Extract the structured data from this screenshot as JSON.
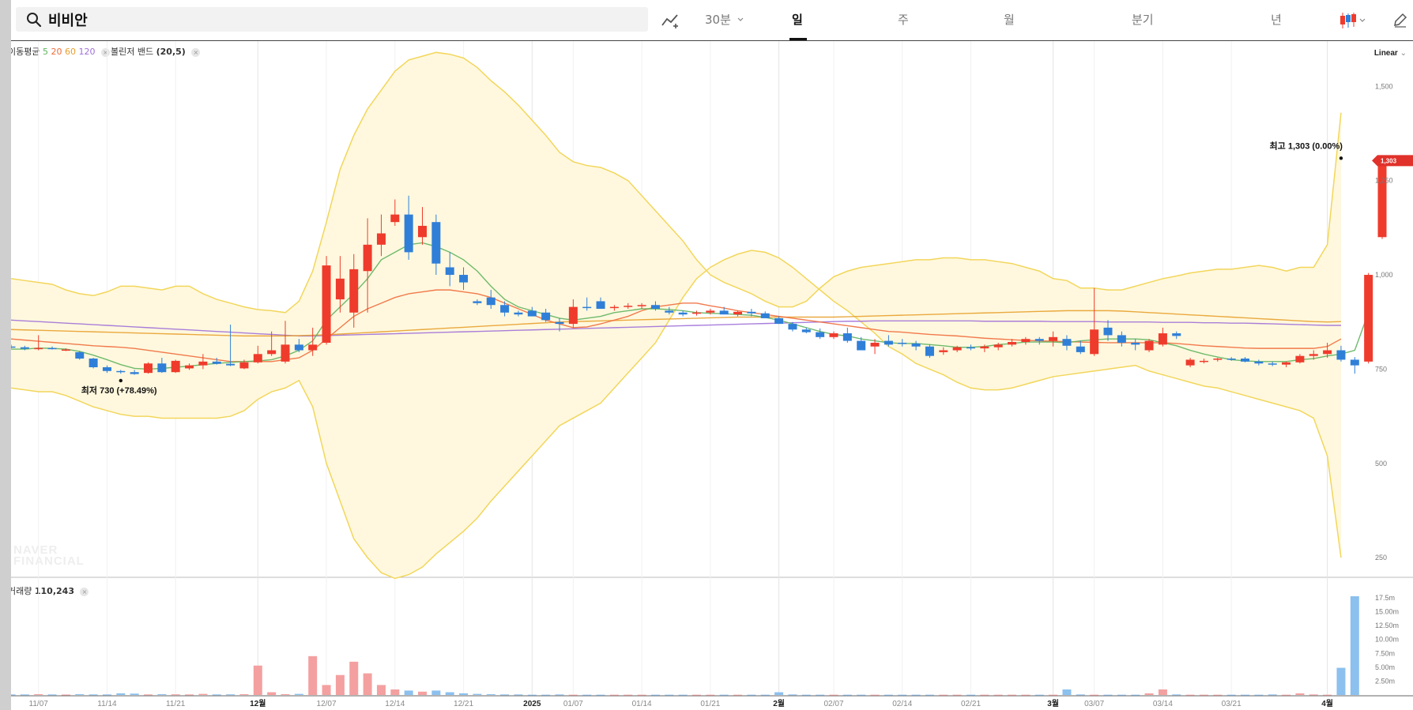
{
  "search": {
    "query": "비비안"
  },
  "toolbar": {
    "interval_30m": "30분",
    "tabs": [
      "일",
      "주",
      "월",
      "분기",
      "년"
    ],
    "active_tab": "일"
  },
  "indicators": {
    "ma_label": "이동평균",
    "ma_periods": [
      "5",
      "20",
      "60",
      "120"
    ],
    "ma_colors": [
      "#5fb35f",
      "#ef6c3c",
      "#e8a02c",
      "#a070d8"
    ],
    "bollinger_label": "볼린저 밴드",
    "bollinger_params": "(20,5)"
  },
  "scale_mode": "Linear",
  "volume": {
    "label": "거래량",
    "value": "110,243"
  },
  "watermark": [
    "NAVER",
    "FINANCIAL"
  ],
  "colors": {
    "up": "#ef3b2c",
    "down": "#2f7fd8",
    "band_fill": "#fff8de",
    "band_line": "#f2d65b",
    "vol_up": "#f4a0a0",
    "vol_down": "#8cc0ef"
  },
  "chart_data": {
    "type": "candlestick",
    "price_axis": {
      "min": 200,
      "max": 1620,
      "ticks": [
        250,
        500,
        750,
        1000,
        1250,
        1500
      ]
    },
    "volume_axis": {
      "max": 18.5,
      "ticks": [
        2.5,
        5.0,
        7.5,
        10.0,
        12.5,
        15.0,
        17.5
      ],
      "tick_labels": [
        "2.50m",
        "5.00m",
        "7.50m",
        "10.00m",
        "12.50m",
        "15.00m",
        "17.5m"
      ]
    },
    "x_labels": [
      {
        "i": 2,
        "t": "11/07",
        "b": false
      },
      {
        "i": 7,
        "t": "11/14",
        "b": false
      },
      {
        "i": 12,
        "t": "11/21",
        "b": false
      },
      {
        "i": 18,
        "t": "12월",
        "b": true
      },
      {
        "i": 23,
        "t": "12/07",
        "b": false
      },
      {
        "i": 28,
        "t": "12/14",
        "b": false
      },
      {
        "i": 33,
        "t": "12/21",
        "b": false
      },
      {
        "i": 38,
        "t": "2025",
        "b": true
      },
      {
        "i": 41,
        "t": "01/07",
        "b": false
      },
      {
        "i": 46,
        "t": "01/14",
        "b": false
      },
      {
        "i": 51,
        "t": "01/21",
        "b": false
      },
      {
        "i": 56,
        "t": "2월",
        "b": true
      },
      {
        "i": 60,
        "t": "02/07",
        "b": false
      },
      {
        "i": 65,
        "t": "02/14",
        "b": false
      },
      {
        "i": 70,
        "t": "02/21",
        "b": false
      },
      {
        "i": 76,
        "t": "3월",
        "b": true
      },
      {
        "i": 79,
        "t": "03/07",
        "b": false
      },
      {
        "i": 84,
        "t": "03/14",
        "b": false
      },
      {
        "i": 89,
        "t": "03/21",
        "b": false
      },
      {
        "i": 96,
        "t": "4월",
        "b": true
      }
    ],
    "candles": [
      [
        810,
        815,
        805,
        808
      ],
      [
        808,
        812,
        800,
        804
      ],
      [
        804,
        840,
        800,
        806
      ],
      [
        806,
        810,
        802,
        805
      ],
      [
        800,
        805,
        798,
        802
      ],
      [
        795,
        798,
        775,
        778
      ],
      [
        778,
        780,
        752,
        755
      ],
      [
        755,
        760,
        740,
        745
      ],
      [
        745,
        748,
        738,
        742
      ],
      [
        742,
        748,
        735,
        737
      ],
      [
        740,
        768,
        738,
        765
      ],
      [
        765,
        780,
        740,
        742
      ],
      [
        742,
        775,
        740,
        772
      ],
      [
        752,
        765,
        748,
        760
      ],
      [
        760,
        790,
        750,
        770
      ],
      [
        770,
        780,
        762,
        764
      ],
      [
        764,
        868,
        758,
        760
      ],
      [
        752,
        775,
        750,
        768
      ],
      [
        768,
        812,
        765,
        790
      ],
      [
        790,
        850,
        785,
        800
      ],
      [
        770,
        878,
        765,
        815
      ],
      [
        815,
        830,
        795,
        800
      ],
      [
        800,
        860,
        785,
        815
      ],
      [
        820,
        1050,
        815,
        1025
      ],
      [
        935,
        1050,
        900,
        990
      ],
      [
        900,
        1055,
        860,
        1015
      ],
      [
        1010,
        1150,
        900,
        1080
      ],
      [
        1080,
        1160,
        1050,
        1110
      ],
      [
        1140,
        1200,
        1130,
        1160
      ],
      [
        1160,
        1210,
        1040,
        1060
      ],
      [
        1100,
        1180,
        1080,
        1130
      ],
      [
        1140,
        1160,
        1000,
        1030
      ],
      [
        1020,
        1060,
        970,
        1000
      ],
      [
        1000,
        1020,
        960,
        980
      ],
      [
        930,
        935,
        920,
        925
      ],
      [
        940,
        960,
        910,
        920
      ],
      [
        920,
        930,
        890,
        900
      ],
      [
        900,
        905,
        890,
        895
      ],
      [
        905,
        915,
        890,
        890
      ],
      [
        900,
        910,
        875,
        880
      ],
      [
        875,
        885,
        850,
        870
      ],
      [
        870,
        935,
        860,
        915
      ],
      [
        915,
        940,
        905,
        912
      ],
      [
        930,
        940,
        910,
        910
      ],
      [
        912,
        920,
        905,
        915
      ],
      [
        915,
        925,
        910,
        918
      ],
      [
        918,
        925,
        910,
        920
      ],
      [
        920,
        930,
        905,
        910
      ],
      [
        905,
        915,
        895,
        900
      ],
      [
        900,
        905,
        890,
        895
      ],
      [
        898,
        905,
        892,
        900
      ],
      [
        900,
        910,
        895,
        905
      ],
      [
        905,
        915,
        895,
        895
      ],
      [
        895,
        905,
        890,
        902
      ],
      [
        902,
        910,
        890,
        898
      ],
      [
        898,
        903,
        885,
        885
      ],
      [
        885,
        890,
        870,
        870
      ],
      [
        870,
        875,
        850,
        855
      ],
      [
        855,
        860,
        845,
        848
      ],
      [
        848,
        858,
        830,
        835
      ],
      [
        835,
        850,
        830,
        845
      ],
      [
        845,
        860,
        820,
        825
      ],
      [
        825,
        835,
        800,
        800
      ],
      [
        810,
        830,
        790,
        820
      ],
      [
        825,
        840,
        810,
        815
      ],
      [
        820,
        830,
        810,
        818
      ],
      [
        818,
        825,
        800,
        810
      ],
      [
        810,
        815,
        780,
        785
      ],
      [
        795,
        808,
        788,
        800
      ],
      [
        800,
        812,
        795,
        808
      ],
      [
        808,
        815,
        800,
        805
      ],
      [
        805,
        815,
        795,
        810
      ],
      [
        808,
        820,
        800,
        815
      ],
      [
        815,
        830,
        810,
        822
      ],
      [
        822,
        835,
        815,
        830
      ],
      [
        830,
        835,
        815,
        825
      ],
      [
        825,
        850,
        810,
        835
      ],
      [
        830,
        840,
        800,
        812
      ],
      [
        810,
        825,
        790,
        795
      ],
      [
        790,
        965,
        785,
        855
      ],
      [
        860,
        880,
        825,
        840
      ],
      [
        840,
        850,
        810,
        820
      ],
      [
        820,
        830,
        800,
        815
      ],
      [
        800,
        830,
        795,
        825
      ],
      [
        815,
        860,
        810,
        845
      ],
      [
        845,
        850,
        830,
        838
      ],
      [
        760,
        780,
        755,
        775
      ],
      [
        770,
        778,
        765,
        772
      ],
      [
        775,
        780,
        770,
        778
      ],
      [
        778,
        782,
        772,
        775
      ],
      [
        778,
        782,
        768,
        770
      ],
      [
        770,
        775,
        760,
        765
      ],
      [
        765,
        770,
        758,
        762
      ],
      [
        762,
        770,
        755,
        768
      ],
      [
        768,
        790,
        765,
        785
      ],
      [
        785,
        800,
        775,
        790
      ],
      [
        790,
        820,
        780,
        800
      ],
      [
        800,
        812,
        770,
        775
      ],
      [
        775,
        782,
        738,
        760
      ],
      [
        770,
        1005,
        765,
        1000
      ],
      [
        1100,
        1303,
        1095,
        1300
      ]
    ],
    "band_upper": [
      990,
      985,
      980,
      975,
      960,
      950,
      945,
      955,
      970,
      970,
      965,
      960,
      970,
      970,
      950,
      935,
      925,
      915,
      908,
      905,
      900,
      930,
      1010,
      1140,
      1280,
      1370,
      1440,
      1490,
      1540,
      1570,
      1580,
      1590,
      1585,
      1575,
      1550,
      1515,
      1485,
      1450,
      1410,
      1370,
      1325,
      1300,
      1290,
      1285,
      1270,
      1250,
      1210,
      1170,
      1130,
      1090,
      1040,
      1000,
      980,
      965,
      950,
      930,
      915,
      915,
      930,
      965,
      995,
      1010,
      1020,
      1025,
      1030,
      1035,
      1040,
      1040,
      1045,
      1045,
      1040,
      1040,
      1035,
      1030,
      1020,
      1010,
      990,
      985,
      965,
      965,
      960,
      960,
      970,
      980,
      990,
      997,
      1005,
      1010,
      1015,
      1015,
      1020,
      1025,
      1020,
      1010,
      1020,
      1020,
      1080,
      1430
    ],
    "band_lower": [
      700,
      695,
      690,
      690,
      680,
      665,
      650,
      640,
      630,
      625,
      625,
      620,
      620,
      620,
      620,
      620,
      625,
      640,
      670,
      690,
      700,
      720,
      650,
      500,
      400,
      300,
      250,
      210,
      195,
      205,
      225,
      260,
      290,
      320,
      355,
      400,
      440,
      480,
      520,
      560,
      600,
      620,
      640,
      660,
      700,
      740,
      780,
      820,
      880,
      940,
      990,
      1020,
      1040,
      1055,
      1065,
      1060,
      1045,
      1020,
      990,
      960,
      930,
      905,
      875,
      845,
      810,
      790,
      765,
      750,
      735,
      715,
      700,
      695,
      695,
      700,
      710,
      720,
      730,
      735,
      740,
      745,
      750,
      755,
      760,
      745,
      735,
      725,
      715,
      705,
      700,
      690,
      680,
      670,
      660,
      650,
      640,
      620,
      520,
      250
    ],
    "ma5": [
      803,
      803,
      806,
      805,
      803,
      797,
      787,
      775,
      762,
      752,
      750,
      752,
      755,
      758,
      762,
      765,
      768,
      770,
      772,
      775,
      785,
      800,
      825,
      880,
      915,
      950,
      990,
      1040,
      1060,
      1080,
      1085,
      1075,
      1060,
      1040,
      1010,
      970,
      935,
      915,
      905,
      895,
      885,
      880,
      885,
      890,
      900,
      905,
      910,
      910,
      908,
      905,
      900,
      898,
      897,
      895,
      893,
      887,
      880,
      870,
      860,
      850,
      842,
      838,
      830,
      825,
      820,
      818,
      818,
      815,
      812,
      808,
      808,
      810,
      815,
      818,
      822,
      822,
      822,
      820,
      825,
      828,
      830,
      830,
      830,
      828,
      820,
      812,
      800,
      790,
      782,
      775,
      772,
      770,
      770,
      770,
      775,
      778,
      785,
      790,
      800,
      900
    ],
    "ma20": [
      830,
      827,
      824,
      821,
      818,
      815,
      812,
      810,
      808,
      805,
      800,
      795,
      790,
      785,
      780,
      775,
      770,
      770,
      770,
      770,
      775,
      780,
      800,
      830,
      860,
      890,
      910,
      925,
      940,
      950,
      955,
      960,
      960,
      955,
      950,
      940,
      925,
      910,
      895,
      880,
      870,
      860,
      862,
      870,
      880,
      890,
      905,
      915,
      920,
      925,
      925,
      918,
      912,
      905,
      900,
      895,
      890,
      885,
      880,
      875,
      870,
      865,
      860,
      855,
      850,
      848,
      845,
      842,
      840,
      838,
      835,
      832,
      830,
      828,
      826,
      825,
      824,
      823,
      822,
      821,
      820,
      820,
      820,
      820,
      820,
      818,
      815,
      812,
      810,
      808,
      806,
      805,
      805,
      805,
      805,
      805,
      810,
      830
    ],
    "ma60": [
      855,
      854,
      853,
      852,
      851,
      850,
      849,
      848,
      847,
      846,
      845,
      844,
      843,
      842,
      841,
      840,
      839,
      838,
      838,
      838,
      838,
      839,
      840,
      841,
      843,
      845,
      847,
      849,
      851,
      853,
      855,
      857,
      859,
      861,
      863,
      865,
      867,
      869,
      871,
      873,
      875,
      876,
      877,
      878,
      879,
      880,
      881,
      882,
      883,
      884,
      885,
      886,
      887,
      888,
      888,
      888,
      888,
      888,
      888,
      888,
      888,
      889,
      890,
      891,
      892,
      893,
      894,
      895,
      896,
      897,
      898,
      899,
      900,
      901,
      902,
      903,
      904,
      905,
      905,
      905,
      905,
      904,
      902,
      900,
      898,
      896,
      894,
      892,
      890,
      888,
      886,
      884,
      882,
      880,
      878,
      876,
      875,
      876
    ],
    "ma120": [
      880,
      878,
      876,
      874,
      872,
      870,
      868,
      866,
      864,
      862,
      860,
      858,
      856,
      854,
      852,
      850,
      848,
      846,
      844,
      842,
      840,
      838,
      838,
      839,
      840,
      841,
      842,
      843,
      844,
      845,
      846,
      847,
      848,
      849,
      850,
      851,
      852,
      853,
      854,
      855,
      856,
      857,
      858,
      859,
      860,
      861,
      862,
      863,
      864,
      865,
      866,
      867,
      868,
      869,
      870,
      871,
      872,
      873,
      874,
      875,
      876,
      877,
      877,
      878,
      878,
      878,
      878,
      878,
      878,
      878,
      878,
      877,
      877,
      877,
      877,
      877,
      876,
      876,
      876,
      876,
      875,
      875,
      875,
      875,
      874,
      874,
      874,
      873,
      873,
      872,
      872,
      871,
      870,
      869,
      868,
      867,
      866,
      866
    ],
    "volume_m": [
      0.1,
      0.1,
      0.15,
      0.1,
      0.08,
      0.15,
      0.1,
      0.1,
      0.3,
      0.25,
      0.1,
      0.15,
      0.12,
      0.1,
      0.2,
      0.1,
      0.12,
      0.15,
      5.3,
      0.5,
      0.15,
      0.2,
      7.0,
      1.8,
      3.6,
      6.0,
      3.9,
      1.8,
      1.0,
      0.8,
      0.6,
      0.8,
      0.5,
      0.3,
      0.2,
      0.15,
      0.1,
      0.1,
      0.05,
      0.05,
      0.1,
      0.05,
      0.05,
      0.05,
      0.05,
      0.05,
      0.05,
      0.05,
      0.05,
      0.05,
      0.05,
      0.05,
      0.05,
      0.05,
      0.05,
      0.05,
      0.5,
      0.1,
      0.05,
      0.05,
      0.05,
      0.05,
      0.05,
      0.05,
      0.05,
      0.05,
      0.05,
      0.05,
      0.05,
      0.05,
      0.05,
      0.05,
      0.05,
      0.05,
      0.05,
      0.05,
      0.05,
      1.0,
      0.1,
      0.05,
      0.05,
      0.05,
      0.05,
      0.3,
      1.0,
      0.1,
      0.05,
      0.05,
      0.05,
      0.05,
      0.05,
      0.05,
      0.1,
      0.05,
      0.3,
      0.1,
      0.05,
      4.9,
      17.8
    ],
    "annotations": {
      "low": {
        "label": "최저 730 (+78.49%)",
        "value": 730,
        "i": 8
      },
      "high": {
        "label": "최고 1,303 (0.00%)",
        "value": 1303,
        "i": 97
      },
      "last_price": "1,303"
    }
  }
}
